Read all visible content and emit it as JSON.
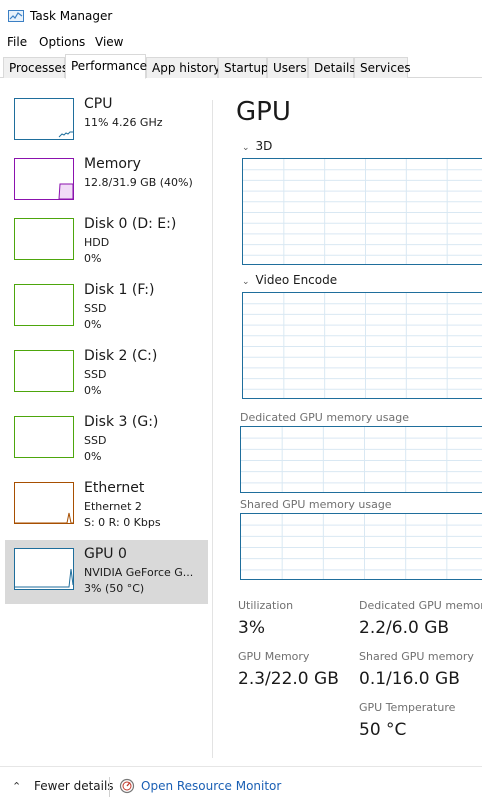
{
  "window": {
    "title": "Task Manager"
  },
  "menu": [
    "File",
    "Options",
    "View"
  ],
  "tabs": [
    {
      "label": "Processes",
      "active": false
    },
    {
      "label": "Performance",
      "active": true
    },
    {
      "label": "App history",
      "active": false
    },
    {
      "label": "Startup",
      "active": false
    },
    {
      "label": "Users",
      "active": false
    },
    {
      "label": "Details",
      "active": false
    },
    {
      "label": "Services",
      "active": false
    }
  ],
  "sidebar": {
    "items": [
      {
        "name": "CPU",
        "line1": "11%  4.26 GHz",
        "line2": "",
        "color": "#1f6e9c"
      },
      {
        "name": "Memory",
        "line1": "12.8/31.9 GB (40%)",
        "line2": "",
        "color": "#8b12ae"
      },
      {
        "name": "Disk 0 (D: E:)",
        "line1": "HDD",
        "line2": "0%",
        "color": "#4da60c"
      },
      {
        "name": "Disk 1 (F:)",
        "line1": "SSD",
        "line2": "0%",
        "color": "#4da60c"
      },
      {
        "name": "Disk 2 (C:)",
        "line1": "SSD",
        "line2": "0%",
        "color": "#4da60c"
      },
      {
        "name": "Disk 3 (G:)",
        "line1": "SSD",
        "line2": "0%",
        "color": "#4da60c"
      },
      {
        "name": "Ethernet",
        "line1": "Ethernet 2",
        "line2": "S: 0  R: 0 Kbps",
        "color": "#a74f01"
      },
      {
        "name": "GPU 0",
        "line1": "NVIDIA GeForce G...",
        "line2": "3% (50 °C)",
        "color": "#1f6e9c",
        "selected": true
      }
    ]
  },
  "main": {
    "title": "GPU",
    "engine_3d": "3D",
    "engine_video": "Video Encode",
    "dedicated_label": "Dedicated GPU memory usage",
    "shared_label": "Shared GPU memory usage",
    "stats": {
      "utilization_label": "Utilization",
      "utilization_value": "3%",
      "dedicated_label": "Dedicated GPU memory",
      "dedicated_value": "2.2/6.0 GB",
      "gpu_memory_label": "GPU Memory",
      "gpu_memory_value": "2.3/22.0 GB",
      "shared_label": "Shared GPU memory",
      "shared_value": "0.1/16.0 GB",
      "temp_label": "GPU Temperature",
      "temp_value": "50 °C"
    }
  },
  "footer": {
    "fewer_details": "Fewer details",
    "resource_monitor": "Open Resource Monitor"
  },
  "icons": {
    "chevron_up": "chevron-up-icon",
    "chevron_down": "chevron-down-icon",
    "resource_monitor": "resource-monitor-icon",
    "app": "task-manager-icon"
  }
}
